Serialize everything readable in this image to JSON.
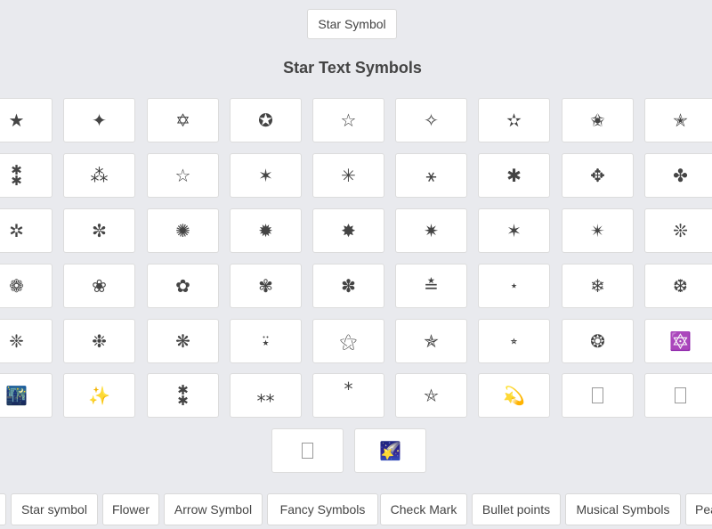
{
  "header": {
    "button_label": "Star Symbol",
    "section_title": "Star Text Symbols"
  },
  "symbols": [
    {
      "glyph": "★",
      "icon": "black-star-icon"
    },
    {
      "glyph": "✦",
      "icon": "four-pointed-star-icon"
    },
    {
      "glyph": "✡",
      "icon": "star-of-david-icon"
    },
    {
      "glyph": "✪",
      "icon": "circled-white-star-icon"
    },
    {
      "glyph": "☆",
      "icon": "white-star-icon"
    },
    {
      "glyph": "✧",
      "icon": "white-four-pointed-star-icon"
    },
    {
      "glyph": "✫",
      "icon": "open-centre-black-star-icon"
    },
    {
      "glyph": "✬",
      "icon": "black-centre-white-star-icon"
    },
    {
      "glyph": "✭",
      "icon": "outlined-black-star-icon"
    },
    {
      "glyph": "⁑",
      "icon": "two-asterisks-vertical-icon"
    },
    {
      "glyph": "⁂",
      "icon": "asterism-icon"
    },
    {
      "glyph": "☆",
      "icon": "white-star-outline-icon"
    },
    {
      "glyph": "✶",
      "icon": "six-pointed-black-star-icon"
    },
    {
      "glyph": "✳",
      "icon": "eight-spoked-asterisk-icon"
    },
    {
      "glyph": "⚹",
      "icon": "sextile-icon"
    },
    {
      "glyph": "✱",
      "icon": "heavy-asterisk-icon"
    },
    {
      "glyph": "✥",
      "icon": "four-club-spoked-asterisk-icon"
    },
    {
      "glyph": "✤",
      "icon": "heavy-four-balloon-asterisk-icon"
    },
    {
      "glyph": "✲",
      "icon": "open-centre-asterisk-icon"
    },
    {
      "glyph": "✼",
      "icon": "open-centre-teardrop-asterisk-icon"
    },
    {
      "glyph": "✺",
      "icon": "sixteen-pointed-asterisk-icon"
    },
    {
      "glyph": "✹",
      "icon": "twelve-pointed-black-star-icon"
    },
    {
      "glyph": "✸",
      "icon": "heavy-eight-pointed-star-icon"
    },
    {
      "glyph": "✷",
      "icon": "eight-pointed-rectilinear-star-icon"
    },
    {
      "glyph": "✶",
      "icon": "six-pointed-star-icon"
    },
    {
      "glyph": "✴",
      "icon": "eight-pointed-black-star-icon"
    },
    {
      "glyph": "❊",
      "icon": "eight-teardrop-propeller-asterisk-icon"
    },
    {
      "glyph": "❁",
      "icon": "eight-petalled-florette-icon"
    },
    {
      "glyph": "❀",
      "icon": "white-florette-icon"
    },
    {
      "glyph": "✿",
      "icon": "black-florette-icon"
    },
    {
      "glyph": "✾",
      "icon": "six-petalled-florette-icon"
    },
    {
      "glyph": "✽",
      "icon": "heavy-teardrop-asterisk-icon"
    },
    {
      "glyph": "≛",
      "icon": "star-equals-icon"
    },
    {
      "glyph": "⋆",
      "icon": "star-operator-icon"
    },
    {
      "glyph": "❄",
      "icon": "snowflake-icon"
    },
    {
      "glyph": "❆",
      "icon": "heavy-chevron-snowflake-icon"
    },
    {
      "glyph": "❈",
      "icon": "heavy-sparkle-icon"
    },
    {
      "glyph": "❉",
      "icon": "balloon-spoked-asterisk-icon"
    },
    {
      "glyph": "❋",
      "icon": "heavy-teardrop-propeller-asterisk-icon"
    },
    {
      "glyph": "⍣",
      "icon": "star-diaeresis-icon"
    },
    {
      "glyph": "⚝",
      "icon": "outlined-white-star-icon"
    },
    {
      "glyph": "✯",
      "icon": "pinwheel-star-icon"
    },
    {
      "glyph": "⭒",
      "icon": "small-white-star-icon"
    },
    {
      "glyph": "❂",
      "icon": "circled-open-centre-star-icon"
    },
    {
      "glyph": "🔯",
      "icon": "dotted-six-pointed-star-icon"
    },
    {
      "glyph": "🌃",
      "icon": "night-with-stars-icon"
    },
    {
      "glyph": "✨",
      "icon": "sparkles-icon"
    },
    {
      "glyph": "⁑",
      "icon": "two-asterisks-icon"
    },
    {
      "glyph": "⁎⁎",
      "icon": "low-double-asterisk-icon"
    },
    {
      "glyph": "*",
      "icon": "asterisk-icon"
    },
    {
      "glyph": "⛤",
      "icon": "pentagram-icon"
    },
    {
      "glyph": "💫",
      "icon": "dizzy-stars-icon"
    },
    {
      "glyph": "",
      "icon": "missing-glyph-icon"
    },
    {
      "glyph": "",
      "icon": "missing-glyph-icon"
    },
    {
      "glyph": "",
      "icon": "missing-glyph-icon"
    },
    {
      "glyph": "🌠",
      "icon": "shooting-star-icon"
    }
  ],
  "tags": [
    {
      "label": "",
      "name": "tag-previous"
    },
    {
      "label": "Star symbol",
      "name": "tag-star-symbol"
    },
    {
      "label": "Flower",
      "name": "tag-flower"
    },
    {
      "label": "Arrow Symbol",
      "name": "tag-arrow-symbol"
    },
    {
      "label": "Fancy Symbols",
      "name": "tag-fancy-symbols"
    },
    {
      "label": "Check Mark",
      "name": "tag-check-mark"
    },
    {
      "label": "Bullet points",
      "name": "tag-bullet-points"
    },
    {
      "label": "Musical Symbols",
      "name": "tag-musical-symbols"
    },
    {
      "label": "Pea",
      "name": "tag-peace"
    }
  ]
}
